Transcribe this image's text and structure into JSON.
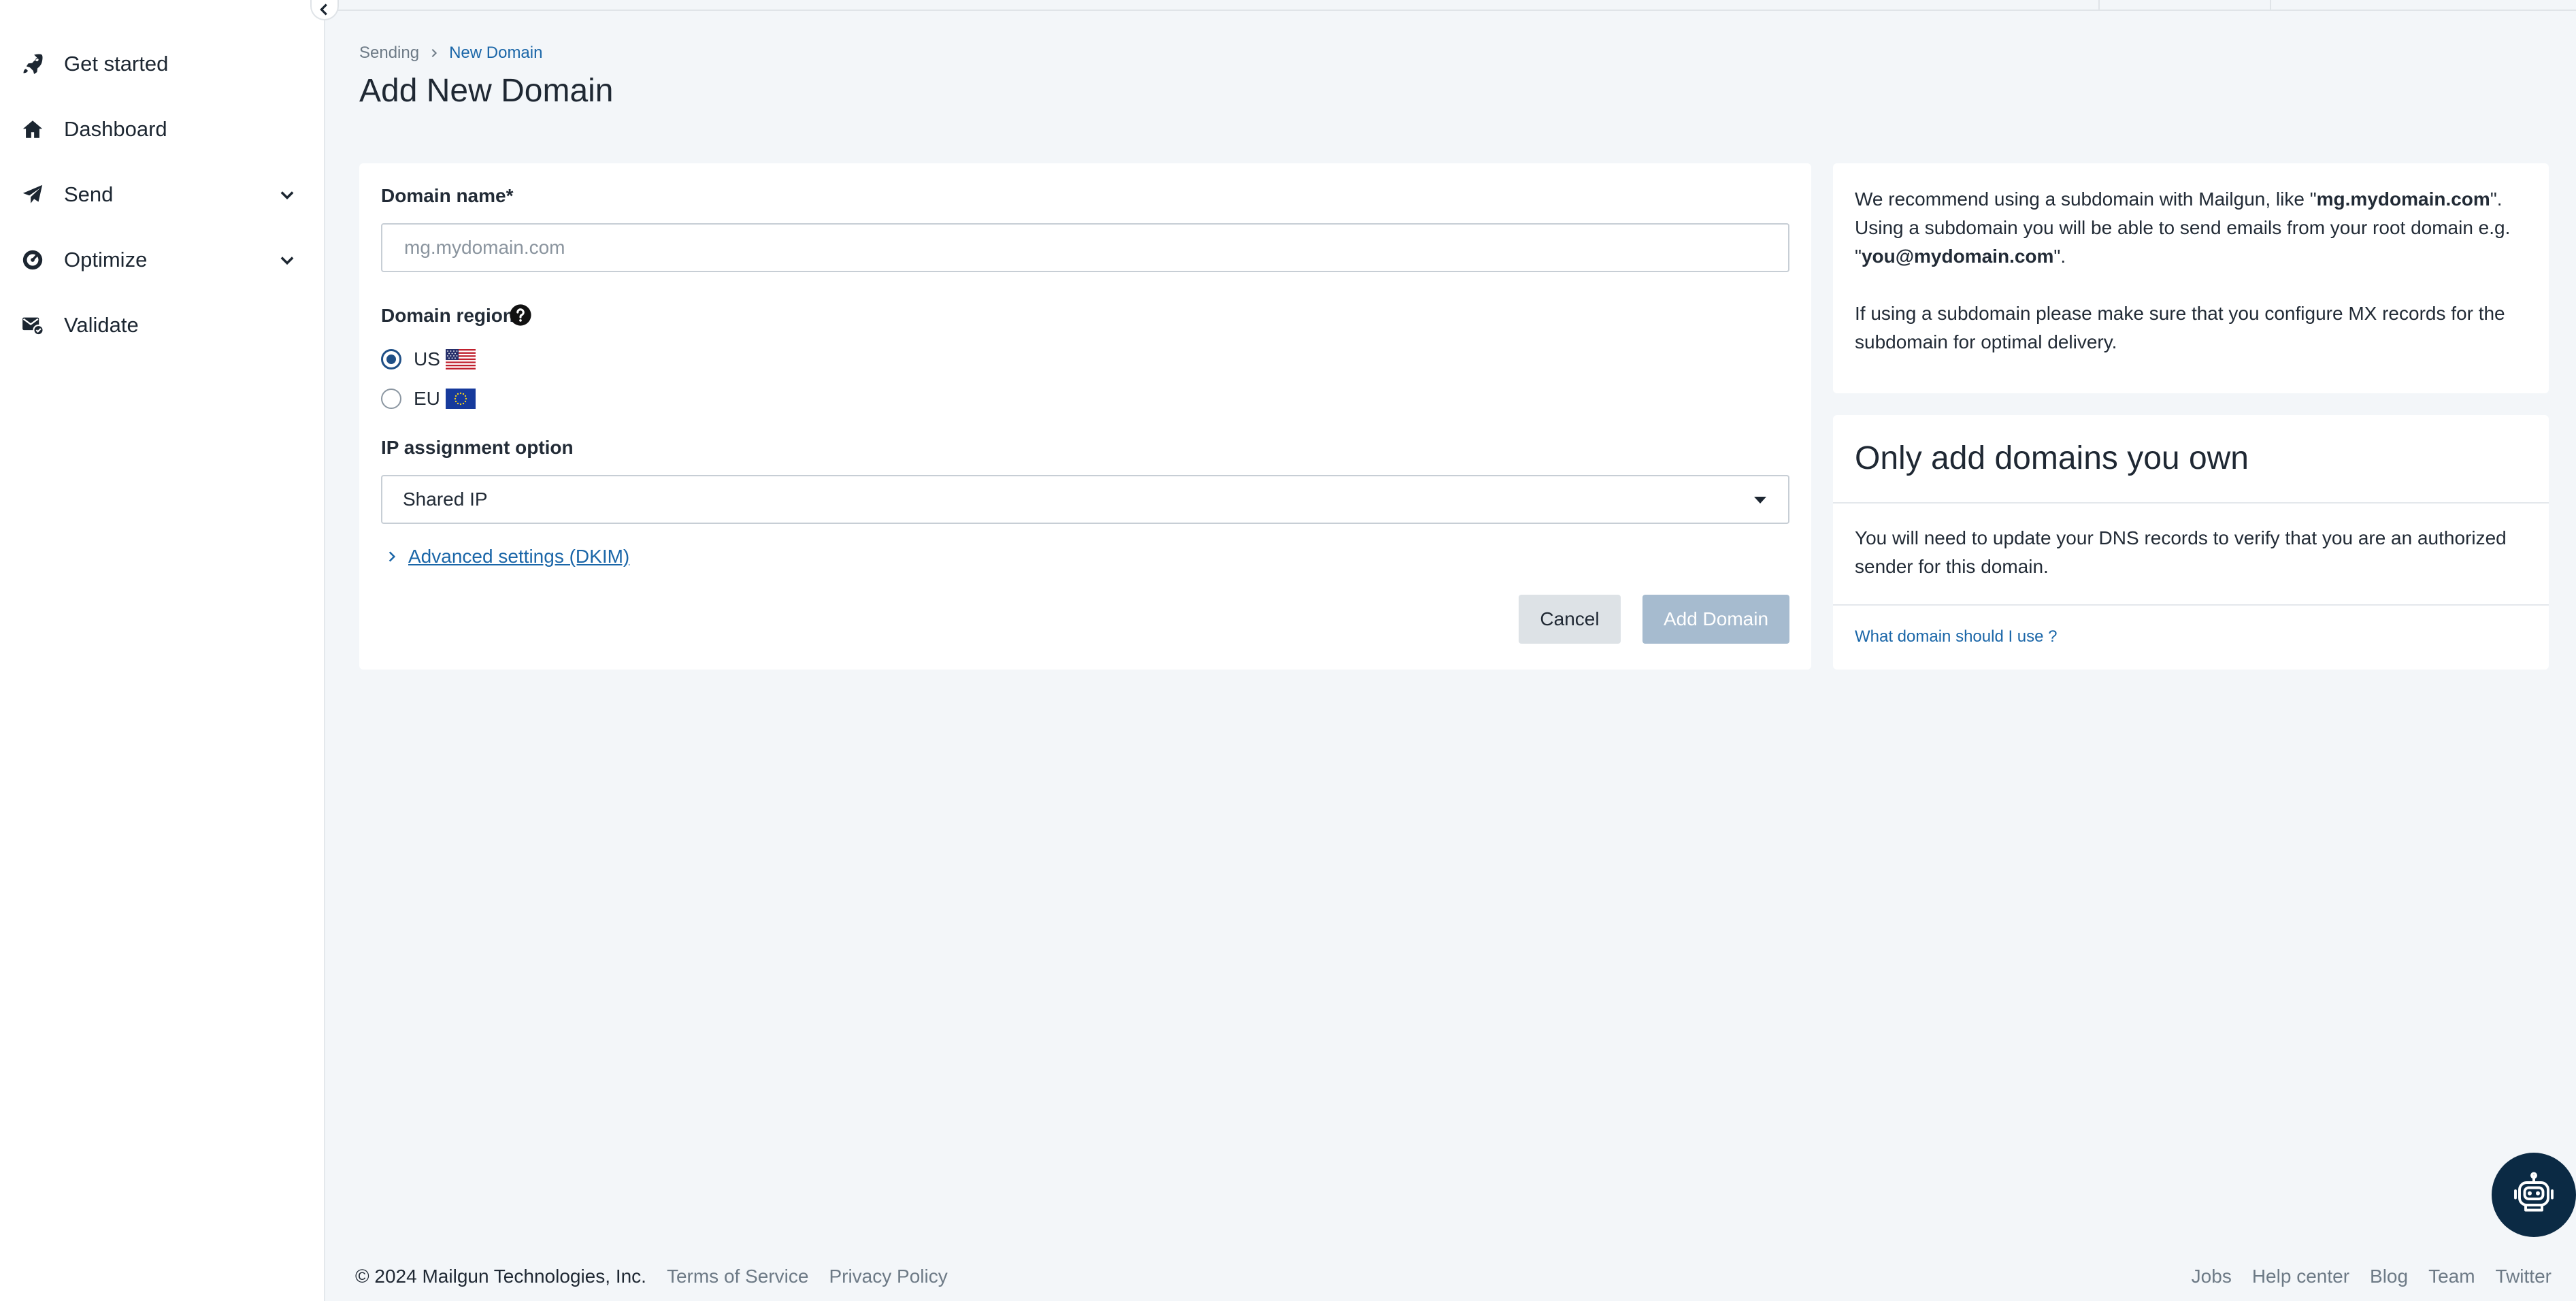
{
  "sidebar": {
    "items": [
      {
        "label": "Get started",
        "icon": "rocket-icon"
      },
      {
        "label": "Dashboard",
        "icon": "home-icon"
      },
      {
        "label": "Send",
        "icon": "paper-plane-icon",
        "expandable": true
      },
      {
        "label": "Optimize",
        "icon": "gauge-icon",
        "expandable": true
      },
      {
        "label": "Validate",
        "icon": "envelope-check-icon"
      }
    ]
  },
  "breadcrumb": {
    "root": "Sending",
    "current": "New Domain"
  },
  "page": {
    "title": "Add New Domain"
  },
  "form": {
    "domain_name_label": "Domain name*",
    "domain_name_placeholder": "mg.mydomain.com",
    "domain_name_value": "",
    "region_label": "Domain region",
    "regions": [
      {
        "label": "US",
        "selected": true
      },
      {
        "label": "EU",
        "selected": false
      }
    ],
    "ip_label": "IP assignment option",
    "ip_value": "Shared IP",
    "advanced_link": "Advanced settings (DKIM)",
    "cancel_label": "Cancel",
    "submit_label": "Add Domain"
  },
  "info": {
    "p1_part1": "We recommend using a subdomain with Mailgun, like \"",
    "p1_bold1": "mg.mydomain.com",
    "p1_part2": "\". Using a subdomain you will be able to send emails from your root domain e.g. \"",
    "p1_bold2": "you@mydomain.com",
    "p1_part3": "\".",
    "p2": "If using a subdomain please make sure that you configure MX records for the subdomain for optimal delivery."
  },
  "own": {
    "title": "Only add domains you own",
    "text": "You will need to update your DNS records to verify that you are an authorized sender for this domain.",
    "link": "What domain should I use ?"
  },
  "footer": {
    "copyright": "© 2024 Mailgun Technologies, Inc.",
    "left_links": [
      "Terms of Service",
      "Privacy Policy"
    ],
    "right_links": [
      "Jobs",
      "Help center",
      "Blog",
      "Team",
      "Twitter"
    ]
  },
  "colors": {
    "accent": "#1a66a8",
    "radio_selected": "#1f4f86",
    "button_disabled": "#a6bbcf",
    "chatbot_bg": "#0b2a44"
  }
}
